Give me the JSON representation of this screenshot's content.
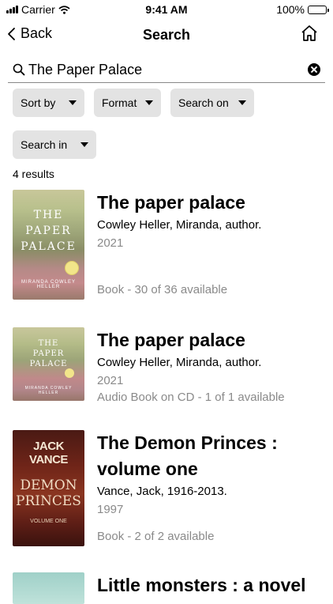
{
  "status": {
    "carrier": "Carrier",
    "time": "9:41 AM",
    "battery": "100%"
  },
  "nav": {
    "back_label": "Back",
    "title": "Search"
  },
  "search": {
    "query": "The Paper Palace"
  },
  "filters": {
    "sort_by": "Sort by",
    "format": "Format",
    "search_on": "Search on",
    "search_in": "Search in"
  },
  "results_count": "4 results",
  "results": [
    {
      "title": "The paper palace",
      "author": "Cowley Heller, Miranda, author.",
      "year": "2021",
      "availability": "Book - 30 of 36 available",
      "cover_text": [
        "THE",
        "PAPER",
        "PALACE"
      ],
      "cover_author": "MIRANDA COWLEY HELLER"
    },
    {
      "title": "The paper palace",
      "author": "Cowley Heller, Miranda, author.",
      "year": "2021",
      "availability": "Audio Book on CD - 1 of 1 available",
      "cover_text": [
        "THE",
        "PAPER",
        "PALACE"
      ],
      "cover_author": "MIRANDA COWLEY HELLER"
    },
    {
      "title_line1": "The Demon Princes :",
      "title_line2": "volume one",
      "author": "Vance, Jack, 1916-2013.",
      "year": "1997",
      "availability": "Book - 2 of 2 available",
      "cover_author": "JACK VANCE",
      "cover_text": [
        "DEMON",
        "PRINCES"
      ],
      "cover_sub": "VOLUME ONE"
    },
    {
      "title": "Little monsters : a novel"
    }
  ]
}
